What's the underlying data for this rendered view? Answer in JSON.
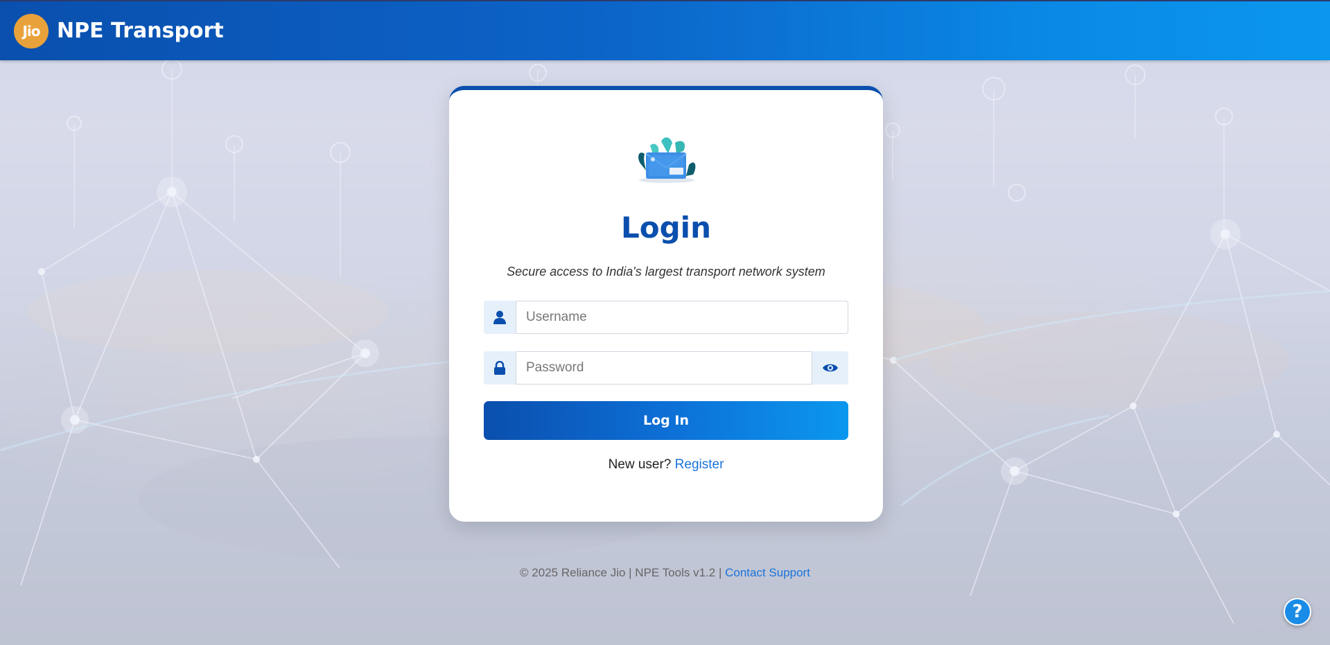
{
  "header": {
    "logo_text": "Jio",
    "title": "NPE Transport",
    "gradient_start": "#0a4fad",
    "gradient_end": "#0b97ee"
  },
  "login": {
    "title": "Login",
    "subtitle": "Secure access to India's largest transport network system",
    "username": {
      "placeholder": "Username",
      "value": "",
      "icon": "user-icon"
    },
    "password": {
      "placeholder": "Password",
      "value": "",
      "icon": "lock-icon",
      "toggle_icon": "eye-icon"
    },
    "submit_label": "Log In",
    "register_prompt": "New user?",
    "register_link": "Register",
    "accent_color": "#0a4fad"
  },
  "footer": {
    "text": "© 2025 Reliance Jio | NPE Tools v1.2 |",
    "support_link": "Contact Support"
  },
  "help_button": {
    "label": "?"
  }
}
